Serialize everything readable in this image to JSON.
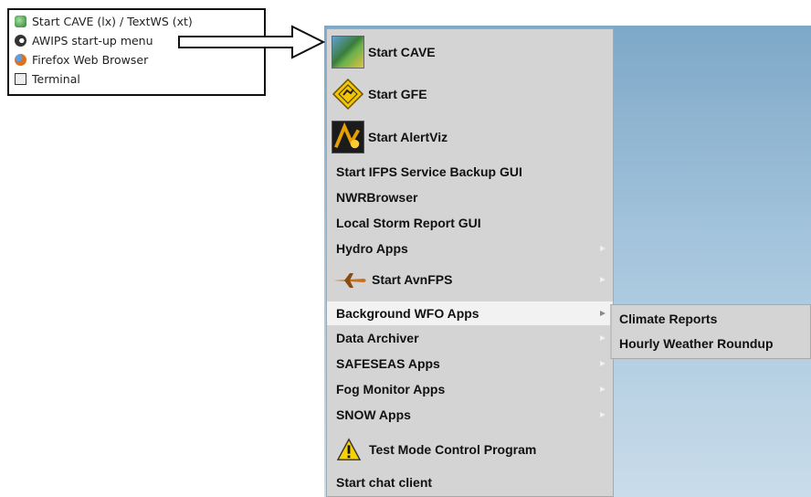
{
  "launcher": {
    "items": [
      {
        "label": "Start CAVE (lx) / TextWS (xt)",
        "icon": "cave-icon"
      },
      {
        "label": "AWIPS start-up menu",
        "icon": "awips-icon"
      },
      {
        "label": "Firefox Web Browser",
        "icon": "firefox-icon"
      },
      {
        "label": "Terminal",
        "icon": "terminal-icon"
      }
    ]
  },
  "menu": {
    "items": [
      {
        "label": "Start CAVE",
        "icon": "cave-globe-icon"
      },
      {
        "label": "Start GFE",
        "icon": "gfe-warning-icon"
      },
      {
        "label": "Start AlertViz",
        "icon": "alertviz-icon"
      },
      {
        "label": "Start IFPS Service Backup GUI"
      },
      {
        "label": "NWRBrowser"
      },
      {
        "label": "Local Storm Report GUI"
      },
      {
        "label": "Hydro Apps",
        "submenu": true
      },
      {
        "label": "Start AvnFPS",
        "icon": "airplane-icon",
        "submenu": true
      },
      {
        "label": "Background WFO Apps",
        "submenu": true,
        "selected": true
      },
      {
        "label": "Data Archiver",
        "submenu": true
      },
      {
        "label": "SAFESEAS Apps",
        "submenu": true
      },
      {
        "label": "Fog Monitor Apps",
        "submenu": true
      },
      {
        "label": "SNOW Apps",
        "submenu": true
      },
      {
        "label": "Test Mode Control Program",
        "icon": "warning-triangle-icon"
      },
      {
        "label": "Start chat client"
      }
    ]
  },
  "submenu": {
    "items": [
      {
        "label": "Climate Reports"
      },
      {
        "label": "Hourly Weather Roundup"
      }
    ]
  },
  "colors": {
    "menu_bg": "#d4d4d4",
    "selected_bg": "#f2f2f2",
    "desktop_top": "#7ea8c8",
    "desktop_bottom": "#c9dcea"
  }
}
